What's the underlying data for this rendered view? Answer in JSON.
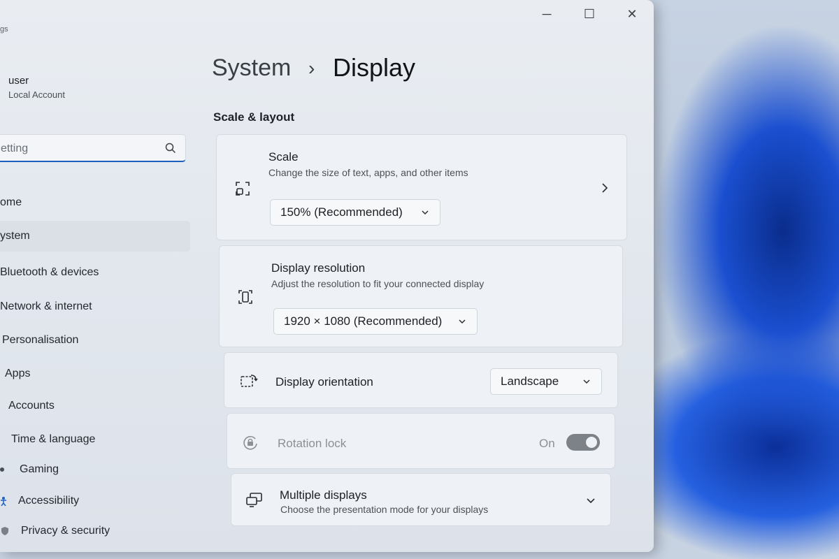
{
  "window": {
    "app_title": "gs",
    "minimize_label": "─",
    "maximize_label": "☐",
    "close_label": "✕"
  },
  "profile": {
    "name": "user",
    "account_type": "Local Account"
  },
  "search": {
    "value": "etting"
  },
  "sidebar": {
    "items": [
      {
        "label": "ome",
        "icon": "home-icon"
      },
      {
        "label": "ystem",
        "icon": "system-icon",
        "selected": true
      },
      {
        "label": "Bluetooth & devices",
        "icon": "bluetooth-icon"
      },
      {
        "label": "Network & internet",
        "icon": "network-icon"
      },
      {
        "label": "Personalisation",
        "icon": "brush-icon"
      },
      {
        "label": "Apps",
        "icon": "apps-icon"
      },
      {
        "label": "Accounts",
        "icon": "accounts-icon"
      },
      {
        "label": "Time & language",
        "icon": "clock-icon"
      },
      {
        "label": "Gaming",
        "icon": "gaming-icon"
      },
      {
        "label": "Accessibility",
        "icon": "accessibility-icon"
      },
      {
        "label": "Privacy & security",
        "icon": "shield-icon"
      }
    ]
  },
  "breadcrumb": {
    "parent": "System",
    "separator": "›",
    "current": "Display"
  },
  "section": {
    "title": "Scale & layout"
  },
  "settings": {
    "scale": {
      "title": "Scale",
      "subtitle": "Change the size of text, apps, and other items",
      "value": "150% (Recommended)"
    },
    "resolution": {
      "title": "Display resolution",
      "subtitle": "Adjust the resolution to fit your connected display",
      "value": "1920 × 1080 (Recommended)"
    },
    "orientation": {
      "title": "Display orientation",
      "value": "Landscape"
    },
    "rotation_lock": {
      "title": "Rotation lock",
      "state_label": "On",
      "enabled": false
    },
    "multiple_displays": {
      "title": "Multiple displays",
      "subtitle": "Choose the presentation mode for your displays"
    }
  },
  "colors": {
    "accent": "#1d5fbf",
    "wallpaper_blue": "#1a4fd0"
  }
}
